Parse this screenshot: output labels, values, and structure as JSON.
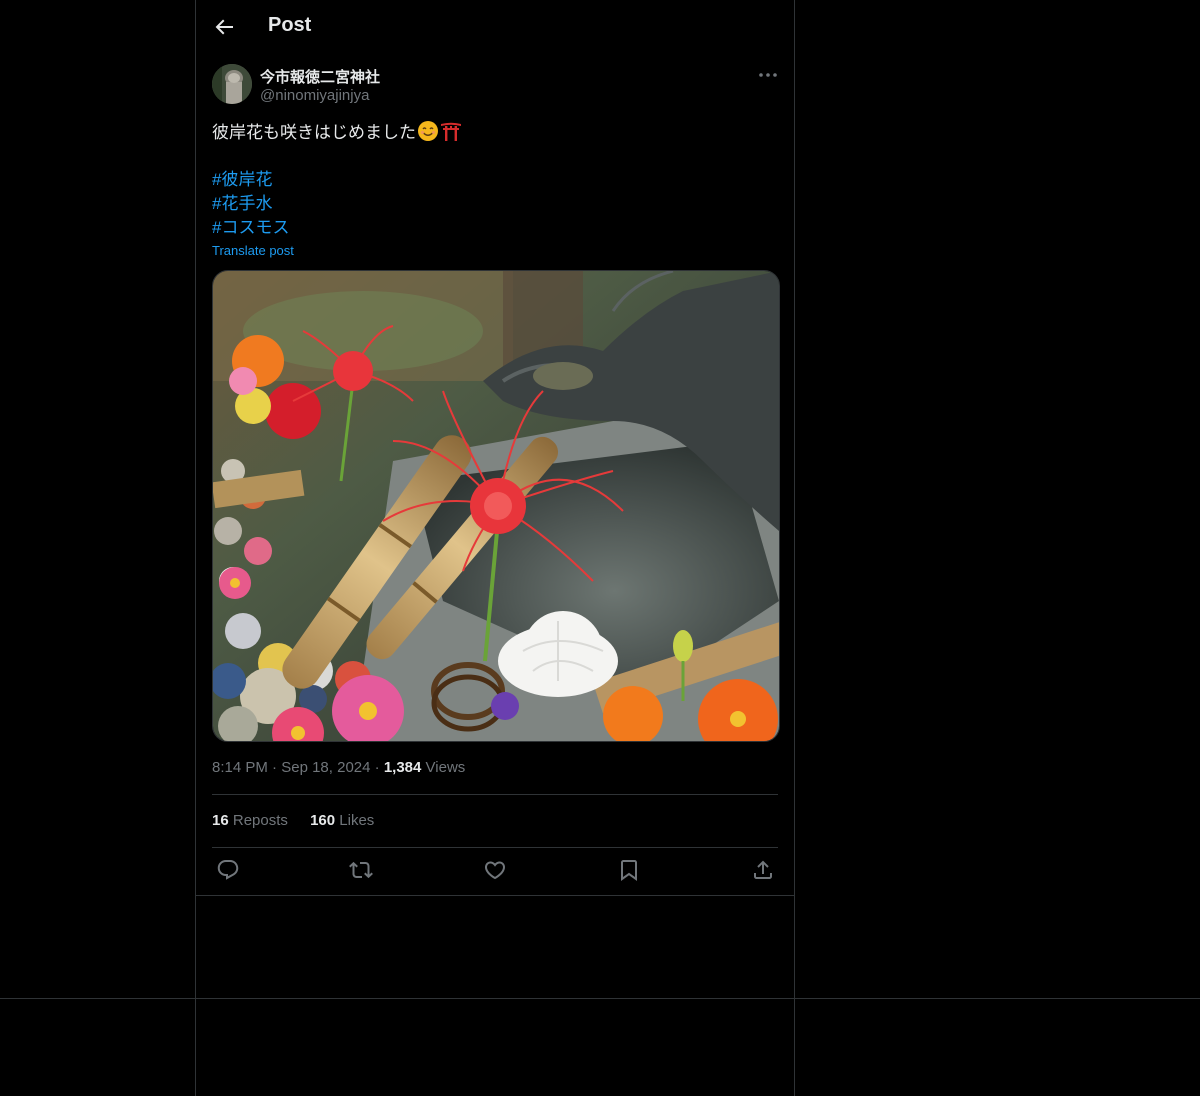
{
  "header": {
    "title": "Post",
    "back_icon": "arrow-left-icon"
  },
  "post": {
    "author_name": "今市報徳二宮神社",
    "author_handle": "@ninomiyajinjya",
    "text": "彼岸花も咲きはじめました",
    "emojis": [
      "smiling-face-icon",
      "shinto-shrine-icon"
    ],
    "hashtags": [
      "#彼岸花",
      "#花手水",
      "#コスモス"
    ],
    "translate_label": "Translate post",
    "time": "8:14 PM",
    "date": "Sep 18, 2024",
    "views_count": "1,384",
    "views_label": "Views",
    "reposts_count": "16",
    "reposts_label": "Reposts",
    "likes_count": "160",
    "likes_label": "Likes"
  },
  "colors": {
    "accent": "#1d9bf0",
    "border": "#2f3336",
    "muted": "#71767b",
    "text": "#e7e9ea"
  }
}
